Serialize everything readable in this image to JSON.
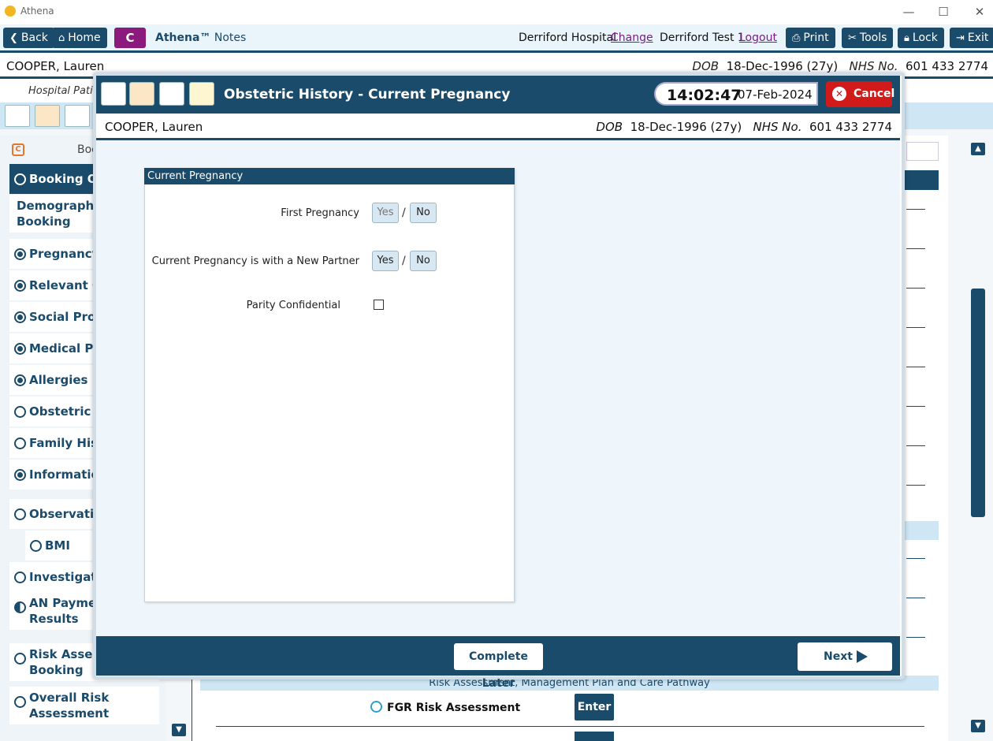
{
  "window": {
    "title": "Athena"
  },
  "toolbar": {
    "back": "Back",
    "home": "Home",
    "c_button": "C",
    "app_name": "Athena™",
    "app_section": "Notes",
    "hospital": "Derriford Hospital",
    "change_link": "Change",
    "user": "Derriford Test 1",
    "logout_link": "Logout",
    "print": "Print",
    "tools": "Tools",
    "lock": "Lock",
    "exit": "Exit"
  },
  "patient": {
    "name": "COOPER, Lauren",
    "dob_label": "DOB",
    "dob_value": "18-Dec-1996 (27y)",
    "nhs_label": "NHS No.",
    "nhs_value": "601 433 2774"
  },
  "background": {
    "hospital_label": "Hospital Patie",
    "sidebar_heading": "Boo",
    "sidebar": [
      {
        "label": "Booking Ove",
        "state": "empty",
        "selected": true
      },
      {
        "label": "Demographics Booking",
        "state": "none"
      },
      {
        "label": "Pregnancy P",
        "state": "full"
      },
      {
        "label": "Relevant Oth",
        "state": "full"
      },
      {
        "label": "Social Profil",
        "state": "full"
      },
      {
        "label": "Medical Pro",
        "state": "full"
      },
      {
        "label": "Allergies",
        "state": "full"
      },
      {
        "label": "Obstetric Hi",
        "state": "empty"
      },
      {
        "label": "Family Histo",
        "state": "empty"
      },
      {
        "label": "Information",
        "state": "full"
      },
      {
        "label": "Observation",
        "state": "empty"
      },
      {
        "label": "BMI",
        "state": "empty"
      },
      {
        "label": "Investigation",
        "state": "empty"
      },
      {
        "label": "AN Paymen Results",
        "state": "half"
      },
      {
        "label": "Risk Assessr Booking",
        "state": "empty"
      },
      {
        "label": "Overall Risk Assessment",
        "state": "empty"
      }
    ],
    "risk_section": "Risk Assessment, Management Plan and Care Pathway",
    "fgr_label": "FGR Risk Assessment",
    "enter_button": "Enter"
  },
  "dialog": {
    "title": "Obstetric History - Current Pregnancy",
    "time": "14:02:47",
    "date": "07-Feb-2024",
    "cancel": "Cancel",
    "panel_title": "Current Pregnancy",
    "fields": {
      "first_pregnancy": "First Pregnancy",
      "new_partner": "Current Pregnancy is with a New Partner",
      "parity_confidential": "Parity Confidential"
    },
    "yes": "Yes",
    "no": "No",
    "slash": "/",
    "complete_later": "Complete Later",
    "next": "Next"
  },
  "colors": {
    "primary": "#1b4b6b",
    "accent": "#8b1a7c",
    "cancel": "#d11a1a",
    "link": "#7a1d8a"
  }
}
